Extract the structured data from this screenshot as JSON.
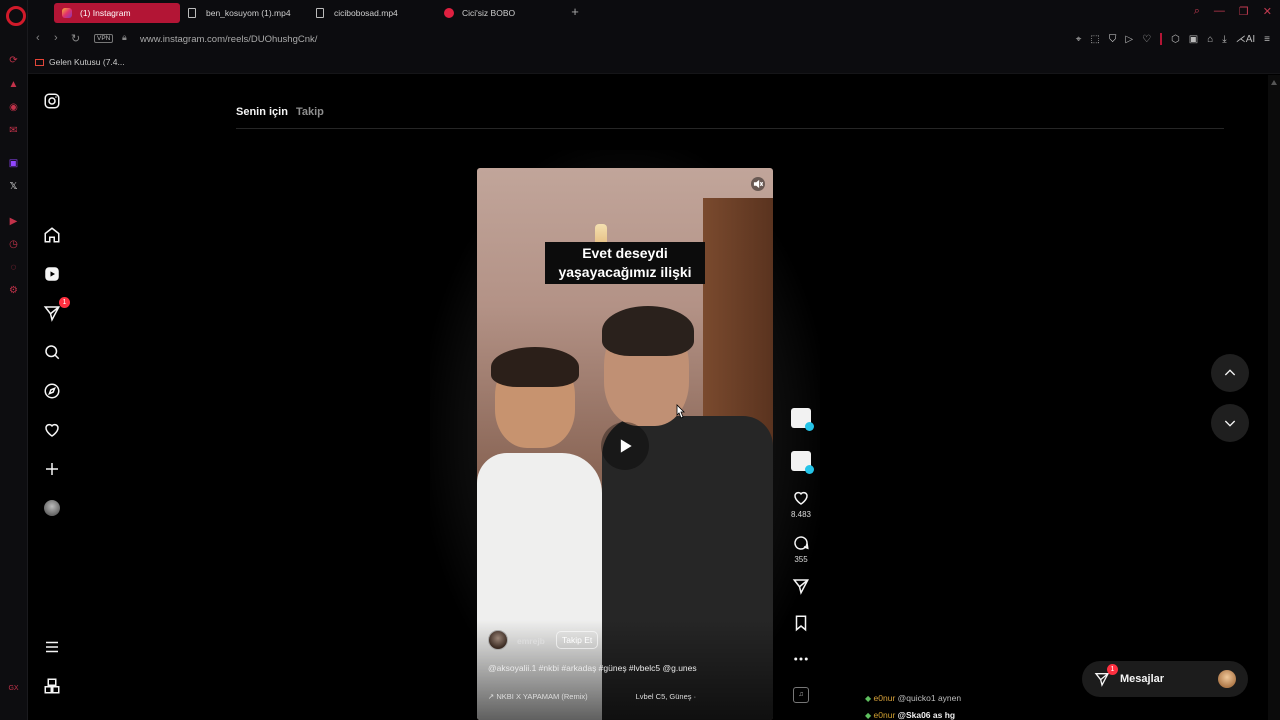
{
  "browser": {
    "tabs": [
      {
        "label": "(1) Instagram",
        "active": true,
        "icon": "instagram-icon"
      },
      {
        "label": "ben_kosuyom (1).mp4",
        "active": false,
        "icon": "file-icon"
      },
      {
        "label": "cicibobosad.mp4",
        "active": false,
        "icon": "file-icon"
      },
      {
        "label": "Cici'siz BOBO",
        "active": false,
        "icon": "youtube-icon"
      }
    ],
    "vpn_label": "VPN",
    "url": "www.instagram.com/reels/DUOhushgCnk/",
    "bookmarks": [
      {
        "label": "Gelen Kutusu (7.4..."
      }
    ],
    "ai_label": "AI",
    "accent_color": "#b31535"
  },
  "instagram": {
    "feed_tabs": [
      {
        "label": "Senin için",
        "active": true
      },
      {
        "label": "Takip",
        "active": false
      }
    ],
    "notifications_badge": "1",
    "reel": {
      "caption_line1": "Evet deseydi",
      "caption_line2": "yaşayacağımız ilişki",
      "author": "emrejb",
      "follow_label": "Takip Et",
      "tags": "@aksoyalii.1 #nkbi #arkadaş #güneş #lvbelc5 @g.unes",
      "audio_track": "↗ NKBI X YAPAMAM (Remix)",
      "audio_artists": "Lvbel C5, Güneş ·",
      "likes": "8.483",
      "comments": "355"
    },
    "messages": {
      "label": "Mesajlar",
      "badge": "1"
    }
  },
  "chat_overlay": [
    {
      "user": "e0nur",
      "message": "@quicko1 aynen",
      "bold": false
    },
    {
      "user": "e0nur",
      "message": "@Ska06 as hg",
      "bold": true
    }
  ]
}
